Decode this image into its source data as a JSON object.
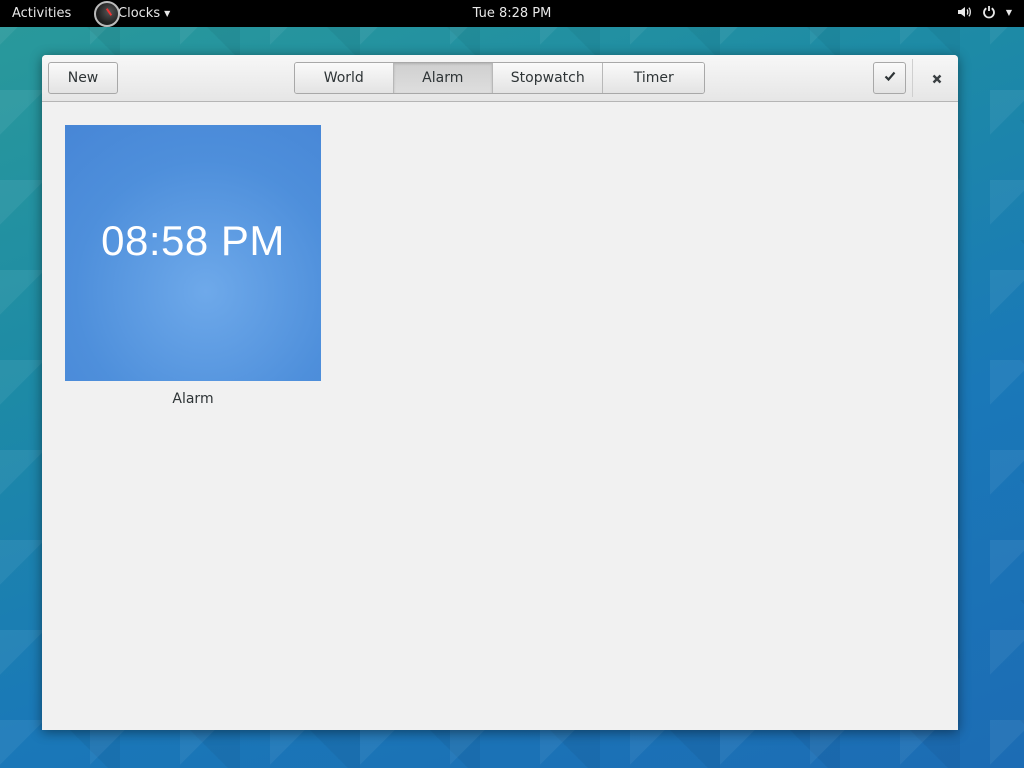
{
  "topbar": {
    "activities": "Activities",
    "app_name": "Clocks",
    "datetime": "Tue  8:28 PM"
  },
  "headerbar": {
    "new_label": "New",
    "tabs": [
      {
        "label": "World",
        "active": false
      },
      {
        "label": "Alarm",
        "active": true
      },
      {
        "label": "Stopwatch",
        "active": false
      },
      {
        "label": "Timer",
        "active": false
      }
    ],
    "select_icon": "checkmark-icon",
    "close_icon": "close-icon"
  },
  "alarms": [
    {
      "time": "08:58 PM",
      "name": "Alarm"
    }
  ],
  "colors": {
    "alarm_tile": "#4e8fdb",
    "topbar": "#000000"
  }
}
